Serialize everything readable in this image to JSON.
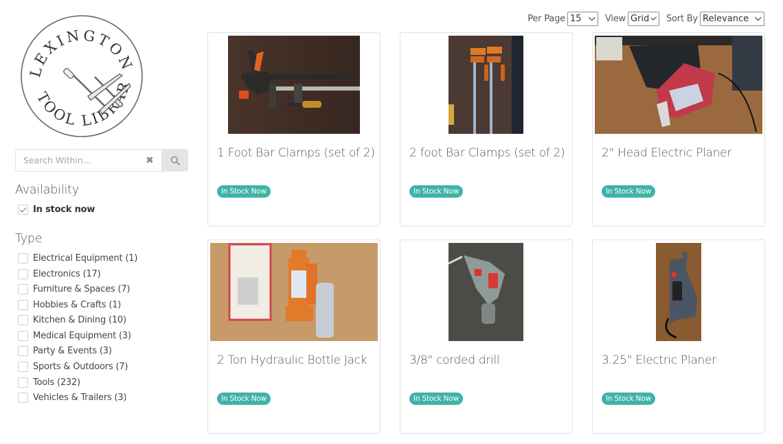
{
  "logo": {
    "top_text": "LEXINGTON",
    "bottom_text": "TOOL LIBRARY"
  },
  "search": {
    "placeholder": "Search Within...",
    "value": "",
    "clear_icon": "times-icon",
    "search_icon": "magnifier-icon"
  },
  "facets": {
    "availability": {
      "title": "Availability",
      "options": [
        {
          "label": "In stock now",
          "checked": true
        }
      ]
    },
    "type": {
      "title": "Type",
      "options": [
        {
          "label": "Electrical Equipment (1)",
          "checked": false
        },
        {
          "label": "Electronics (17)",
          "checked": false
        },
        {
          "label": "Furniture & Spaces (7)",
          "checked": false
        },
        {
          "label": "Hobbies & Crafts (1)",
          "checked": false
        },
        {
          "label": "Kitchen & Dining (10)",
          "checked": false
        },
        {
          "label": "Medical Equipment (3)",
          "checked": false
        },
        {
          "label": "Party & Events (3)",
          "checked": false
        },
        {
          "label": "Sports & Outdoors (7)",
          "checked": false
        },
        {
          "label": "Tools (232)",
          "checked": false
        },
        {
          "label": "Vehicles & Trailers (3)",
          "checked": false
        }
      ]
    }
  },
  "toolbar": {
    "per_page_label": "Per Page",
    "per_page_value": "15",
    "view_label": "View",
    "view_value": "Grid",
    "sort_label": "Sort By",
    "sort_value": "Relevance"
  },
  "items": [
    {
      "title": "1 Foot Bar Clamps (set of 2)",
      "badge": "In Stock Now",
      "image": "bar-clamps-photo"
    },
    {
      "title": "2 foot Bar Clamps (set of 2)",
      "badge": "In Stock Now",
      "image": "long-bar-clamps-photo"
    },
    {
      "title": "2\" Head Electric Planer",
      "badge": "In Stock Now",
      "image": "electric-planer-photo"
    },
    {
      "title": "2 Ton Hydraulic Bottle Jack",
      "badge": "In Stock Now",
      "image": "bottle-jack-photo"
    },
    {
      "title": "3/8\" corded drill",
      "badge": "In Stock Now",
      "image": "corded-drill-photo"
    },
    {
      "title": "3.25\" Electric Planer",
      "badge": "In Stock Now",
      "image": "handheld-planer-photo"
    }
  ],
  "colors": {
    "badge": "#3fb3a6",
    "card_border": "#e1e1e1",
    "search_button": "#e4e4e4"
  }
}
